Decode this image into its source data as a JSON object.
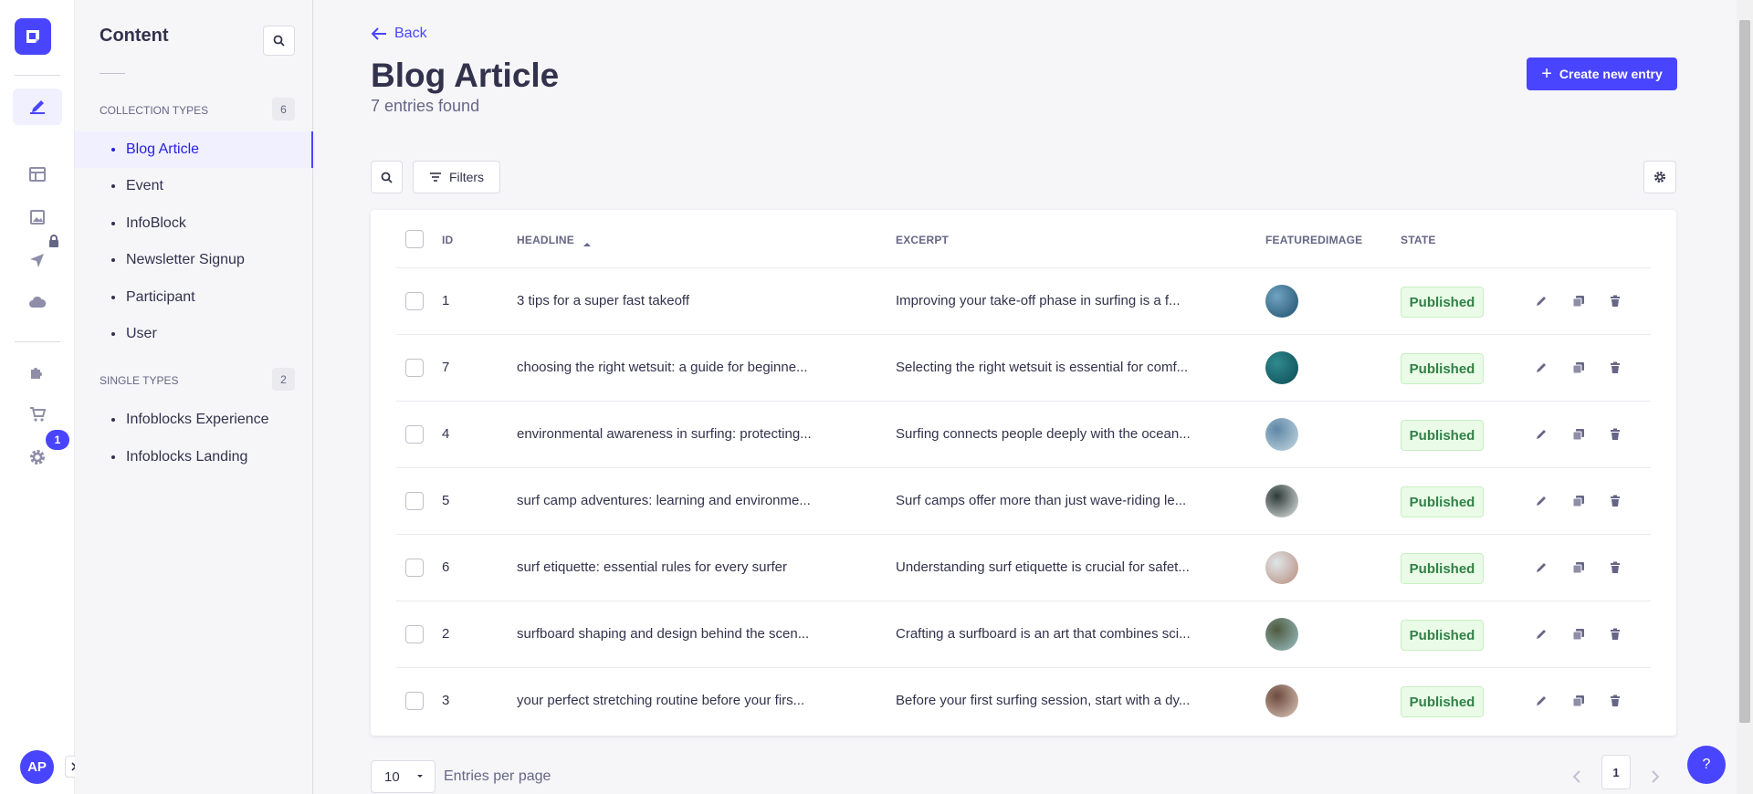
{
  "rail": {
    "icons": [
      "logo-icon",
      "content-manager-icon",
      "content-type-builder-icon",
      "media-library-icon",
      "releases-icon",
      "deploy-icon",
      "plugins-icon",
      "marketplace-icon",
      "settings-icon"
    ],
    "settings_badge": "1",
    "avatar_initials": "AP"
  },
  "subnav": {
    "title": "Content",
    "collection_types": {
      "label": "COLLECTION TYPES",
      "count": "6",
      "items": [
        "Blog Article",
        "Event",
        "InfoBlock",
        "Newsletter Signup",
        "Participant",
        "User"
      ]
    },
    "single_types": {
      "label": "SINGLE TYPES",
      "count": "2",
      "items": [
        "Infoblocks Experience",
        "Infoblocks Landing"
      ]
    },
    "active_item": "Blog Article"
  },
  "header": {
    "back_label": "Back",
    "title": "Blog Article",
    "subtitle": "7 entries found",
    "create_label": "Create new entry"
  },
  "toolbar": {
    "filters_label": "Filters"
  },
  "table": {
    "columns": {
      "id": "ID",
      "headline": "HEADLINE",
      "excerpt": "EXCERPT",
      "image": "FEATUREDIMAGE",
      "state": "STATE"
    },
    "rows": [
      {
        "id": "1",
        "headline": "3 tips for a super fast takeoff",
        "excerpt": "Improving your take-off phase in surfing is a f...",
        "state": "Published",
        "thumb": [
          "#1f4e6b",
          "#6fa4c2"
        ]
      },
      {
        "id": "7",
        "headline": "choosing the right wetsuit: a guide for beginne...",
        "excerpt": "Selecting the right wetsuit is essential for comf...",
        "state": "Published",
        "thumb": [
          "#0d4a52",
          "#2f8a8f"
        ]
      },
      {
        "id": "4",
        "headline": "environmental awareness in surfing: protecting...",
        "excerpt": "Surfing connects people deeply with the ocean...",
        "state": "Published",
        "thumb": [
          "#c9d9e3",
          "#5d88a6"
        ]
      },
      {
        "id": "5",
        "headline": "surf camp adventures: learning and environme...",
        "excerpt": "Surf camps offer more than just wave-riding le...",
        "state": "Published",
        "thumb": [
          "#e4e8e6",
          "#2c3a38"
        ]
      },
      {
        "id": "6",
        "headline": "surf etiquette: essential rules for every surfer",
        "excerpt": "Understanding surf etiquette is crucial for safet...",
        "state": "Published",
        "thumb": [
          "#b78a7a",
          "#dfe5e8"
        ]
      },
      {
        "id": "2",
        "headline": "surfboard shaping and design behind the scen...",
        "excerpt": "Crafting a surfboard is an art that combines sci...",
        "state": "Published",
        "thumb": [
          "#9cc2c9",
          "#4f5a3e"
        ]
      },
      {
        "id": "3",
        "headline": "your perfect stretching routine before your firs...",
        "excerpt": "Before your first surfing session, start with a dy...",
        "state": "Published",
        "thumb": [
          "#dcc9bd",
          "#6d4a3c"
        ]
      }
    ]
  },
  "pagination": {
    "per_page_value": "10",
    "per_page_label": "Entries per page",
    "current_page": "1"
  },
  "help_label": "?",
  "colors": {
    "accent": "#4945ff",
    "published_bg": "#eafbe7",
    "published_text": "#328048"
  }
}
